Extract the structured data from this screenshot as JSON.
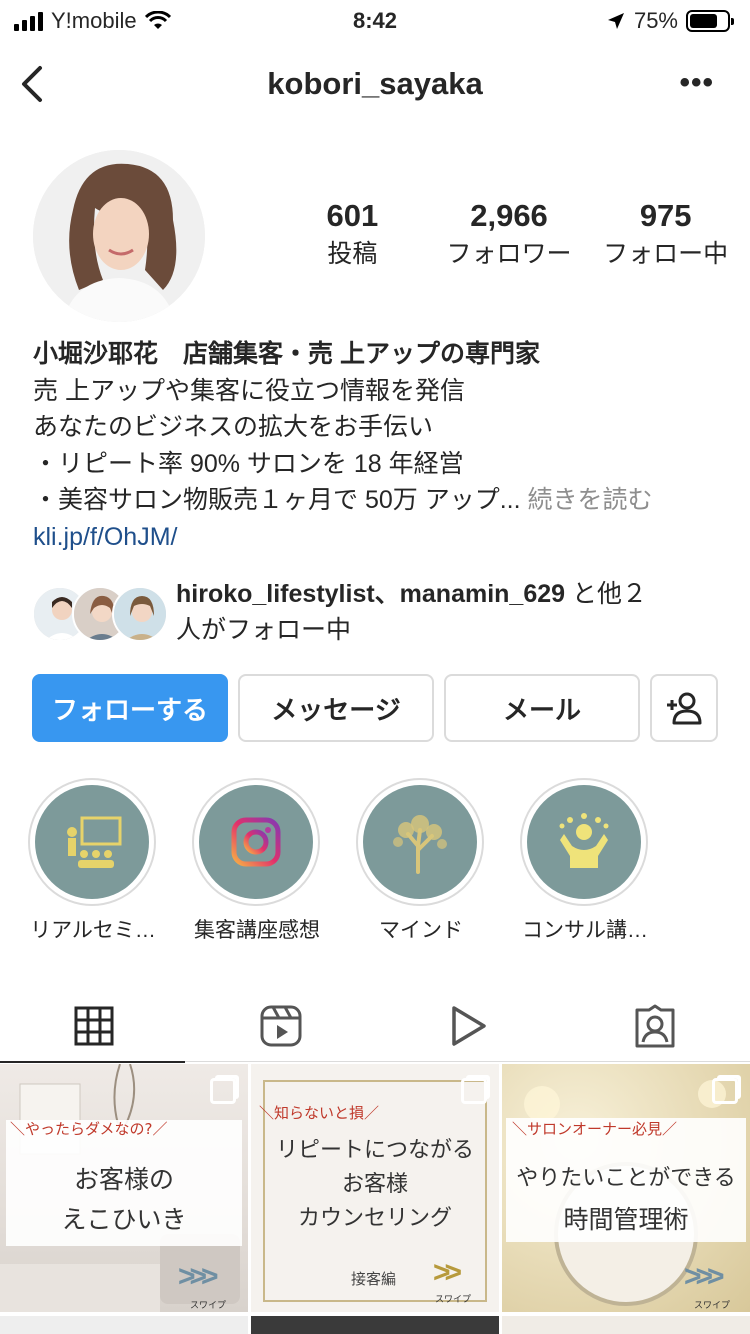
{
  "status_bar": {
    "carrier": "Y!mobile",
    "time": "8:42",
    "battery": "75%",
    "battery_level": 0.75
  },
  "header": {
    "username": "kobori_sayaka",
    "more": "•••"
  },
  "stats": [
    {
      "num": "601",
      "label": "投稿"
    },
    {
      "num": "2,966",
      "label": "フォロワー"
    },
    {
      "num": "975",
      "label": "フォロー中"
    }
  ],
  "bio": {
    "name": "小堀沙耶花　店舗集客・売 上アップの専門家",
    "lines": [
      "売 上アップや集客に役立つ情報を発信",
      "あなたのビジネスの拡大をお手伝い",
      "・リピート率 90% サロンを 18 年経営",
      "・美容サロン物販売１ヶ月で 50万 アップ..."
    ],
    "more_link": " 続きを読む",
    "url": "kli.jp/f/OhJM/"
  },
  "followed_by": {
    "users": "hiroko_lifestylist、manamin_629",
    "rest_1": " と他２",
    "rest_2": "人がフォロー中"
  },
  "buttons": {
    "follow": "フォローする",
    "message": "メッセージ",
    "mail": "メール"
  },
  "highlights": [
    {
      "label": "リアルセミ…",
      "icon": "seminar-icon"
    },
    {
      "label": "集客講座感想",
      "icon": "instagram-icon"
    },
    {
      "label": "マインド",
      "icon": "tree-icon"
    },
    {
      "label": "コンサル講…",
      "icon": "celebrate-icon"
    }
  ],
  "tabs": [
    "grid-icon",
    "reels-icon",
    "video-icon",
    "tagged-icon"
  ],
  "posts": [
    {
      "tag": "＼やったらダメなの?／",
      "line1": "お客様の",
      "line2": "えこひいき",
      "swipe": "スワイプ"
    },
    {
      "tag": "＼知らないと損／",
      "line1": "リピートにつながる",
      "line2": "お客様",
      "line3": "カウンセリング",
      "sub": "接客編",
      "swipe": "スワイプ"
    },
    {
      "tag": "＼サロンオーナー必見／",
      "line1": "やりたいことができる",
      "line2": "時間管理術",
      "swipe": "スワイプ"
    }
  ],
  "colors": {
    "primary": "#3897f0",
    "link": "#1f4f8b",
    "highlight_bg": "#7d9a9a"
  }
}
